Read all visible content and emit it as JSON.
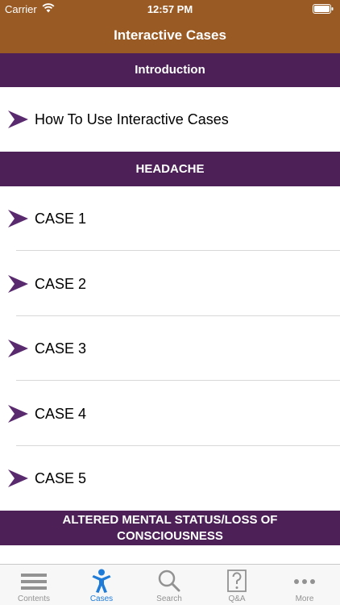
{
  "status_bar": {
    "carrier": "Carrier",
    "time": "12:57 PM"
  },
  "nav": {
    "title": "Interactive Cases"
  },
  "sections": [
    {
      "header": "Introduction",
      "items": [
        "How To Use Interactive Cases"
      ]
    },
    {
      "header": "HEADACHE",
      "items": [
        "CASE 1",
        "CASE 2",
        "CASE 3",
        "CASE 4",
        "CASE 5"
      ]
    },
    {
      "header": "ALTERED MENTAL STATUS/LOSS OF CONSCIOUSNESS",
      "items": []
    }
  ],
  "tabs": [
    {
      "label": "Contents",
      "icon": "list-icon"
    },
    {
      "label": "Cases",
      "icon": "person-icon"
    },
    {
      "label": "Search",
      "icon": "search-icon"
    },
    {
      "label": "Q&A",
      "icon": "question-icon"
    },
    {
      "label": "More",
      "icon": "more-icon"
    }
  ],
  "active_tab": 1,
  "colors": {
    "nav_bar": "#9a5a24",
    "section_header": "#4d2157",
    "arrow": "#5a2a6f",
    "active_tab": "#1f7bd8"
  }
}
